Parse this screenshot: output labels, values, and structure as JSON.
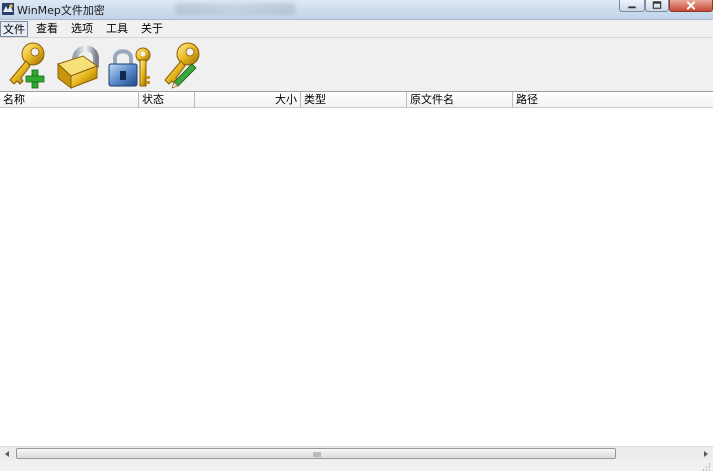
{
  "window": {
    "title": "WinMep文件加密",
    "icon": "app-icon"
  },
  "menu": [
    {
      "label": "文件",
      "active": true
    },
    {
      "label": "查看",
      "active": false
    },
    {
      "label": "选项",
      "active": false
    },
    {
      "label": "工具",
      "active": false
    },
    {
      "label": "关于",
      "active": false
    }
  ],
  "toolbar": [
    {
      "name": "add-key-button",
      "icon": "key-add-icon"
    },
    {
      "name": "lock-button",
      "icon": "padlock-icon"
    },
    {
      "name": "unlock-button",
      "icon": "padlock-key-icon"
    },
    {
      "name": "edit-key-button",
      "icon": "key-edit-icon"
    }
  ],
  "columns": [
    {
      "label": "名称"
    },
    {
      "label": "状态"
    },
    {
      "label": "大小"
    },
    {
      "label": "类型"
    },
    {
      "label": "原文件名"
    },
    {
      "label": "路径"
    }
  ],
  "rows": [],
  "colors": {
    "titlebar": "#cddcee",
    "chrome": "#f0f0f0",
    "list_background": "#ffffff",
    "close_button": "#c84a35"
  }
}
